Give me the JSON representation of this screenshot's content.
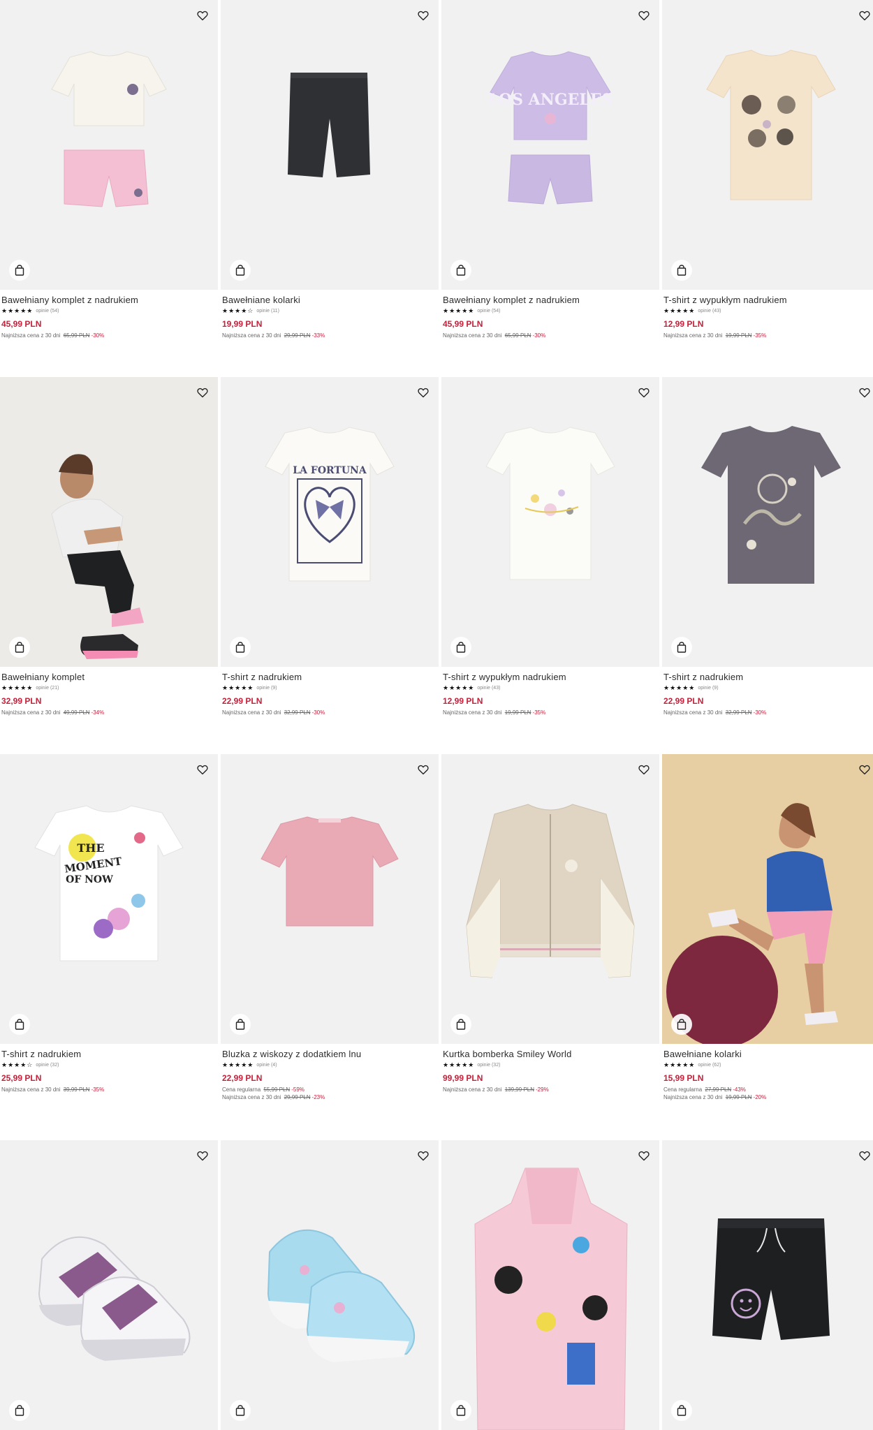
{
  "accent_color": "#c6213b",
  "icons": {
    "favorite": "heart-outline-icon",
    "add_to_bag": "shopping-bag-icon"
  },
  "products": [
    {
      "name": "Bawełniany komplet z nadrukiem",
      "stars": "★★★★★",
      "reviews": "opinie (54)",
      "price": "45,99 PLN",
      "regular_label": "",
      "regular_price": "",
      "regular_discount": "",
      "lowest_label": "Najniższa cena z 30 dni",
      "lowest_price": "65,99 PLN",
      "lowest_discount": "-30%",
      "art": "set-white",
      "image_text": ""
    },
    {
      "name": "Bawełniane kolarki",
      "stars": "★★★★☆",
      "reviews": "opinie (11)",
      "price": "19,99 PLN",
      "regular_label": "",
      "regular_price": "",
      "regular_discount": "",
      "lowest_label": "Najniższa cena z 30 dni",
      "lowest_price": "29,99 PLN",
      "lowest_discount": "-33%",
      "art": "shorts-black",
      "image_text": ""
    },
    {
      "name": "Bawełniany komplet z nadrukiem",
      "stars": "★★★★★",
      "reviews": "opinie (54)",
      "price": "45,99 PLN",
      "regular_label": "",
      "regular_price": "",
      "regular_discount": "",
      "lowest_label": "Najniższa cena z 30 dni",
      "lowest_price": "65,99 PLN",
      "lowest_discount": "-30%",
      "art": "set-lilac",
      "image_text": "LOS ANGELES"
    },
    {
      "name": "T-shirt z wypukłym nadrukiem",
      "stars": "★★★★★",
      "reviews": "opinie (43)",
      "price": "12,99 PLN",
      "regular_label": "",
      "regular_price": "",
      "regular_discount": "",
      "lowest_label": "Najniższa cena z 30 dni",
      "lowest_price": "19,99 PLN",
      "lowest_discount": "-35%",
      "art": "tee-cream",
      "image_text": ""
    },
    {
      "name": "Bawełniany komplet",
      "stars": "★★★★★",
      "reviews": "opinie (21)",
      "price": "32,99 PLN",
      "regular_label": "",
      "regular_price": "",
      "regular_discount": "",
      "lowest_label": "Najniższa cena z 30 dni",
      "lowest_price": "49,99 PLN",
      "lowest_discount": "-34%",
      "art": "model-squat",
      "image_text": ""
    },
    {
      "name": "T-shirt z nadrukiem",
      "stars": "★★★★★",
      "reviews": "opinie (9)",
      "price": "22,99 PLN",
      "regular_label": "",
      "regular_price": "",
      "regular_discount": "",
      "lowest_label": "Najniższa cena z 30 dni",
      "lowest_price": "32,99 PLN",
      "lowest_discount": "-30%",
      "art": "tee-fortuna",
      "image_text": "LA FORTUNA"
    },
    {
      "name": "T-shirt z wypukłym nadrukiem",
      "stars": "★★★★★",
      "reviews": "opinie (43)",
      "price": "12,99 PLN",
      "regular_label": "",
      "regular_price": "",
      "regular_discount": "",
      "lowest_label": "Najniższa cena z 30 dni",
      "lowest_price": "19,99 PLN",
      "lowest_discount": "-35%",
      "art": "tee-white-planets",
      "image_text": ""
    },
    {
      "name": "T-shirt z nadrukiem",
      "stars": "★★★★★",
      "reviews": "opinie (9)",
      "price": "22,99 PLN",
      "regular_label": "",
      "regular_price": "",
      "regular_discount": "",
      "lowest_label": "Najniższa cena z 30 dni",
      "lowest_price": "32,99 PLN",
      "lowest_discount": "-30%",
      "art": "tee-grey",
      "image_text": ""
    },
    {
      "name": "T-shirt z nadrukiem",
      "stars": "★★★★☆",
      "reviews": "opinie (32)",
      "price": "25,99 PLN",
      "regular_label": "",
      "regular_price": "",
      "regular_discount": "",
      "lowest_label": "Najniższa cena z 30 dni",
      "lowest_price": "39,99 PLN",
      "lowest_discount": "-35%",
      "art": "tee-moment",
      "image_text": "THE MOMENT OF NOW"
    },
    {
      "name": "Bluzka z wiskozy z dodatkiem lnu",
      "stars": "★★★★★",
      "reviews": "opinie (4)",
      "price": "22,99 PLN",
      "regular_label": "Cena regularna",
      "regular_price": "55,99 PLN",
      "regular_discount": "-59%",
      "lowest_label": "Najniższa cena z 30 dni",
      "lowest_price": "29,99 PLN",
      "lowest_discount": "-23%",
      "art": "top-pink",
      "image_text": ""
    },
    {
      "name": "Kurtka bomberka Smiley World",
      "stars": "★★★★★",
      "reviews": "opinie (32)",
      "price": "99,99 PLN",
      "regular_label": "",
      "regular_price": "",
      "regular_discount": "",
      "lowest_label": "Najniższa cena z 30 dni",
      "lowest_price": "139,99 PLN",
      "lowest_discount": "-29%",
      "art": "bomber",
      "image_text": ""
    },
    {
      "name": "Bawełniane kolarki",
      "stars": "★★★★★",
      "reviews": "opinie (62)",
      "price": "15,99 PLN",
      "regular_label": "Cena regularna",
      "regular_price": "27,99 PLN",
      "regular_discount": "-43%",
      "lowest_label": "Najniższa cena z 30 dni",
      "lowest_price": "19,99 PLN",
      "lowest_discount": "-20%",
      "art": "model-ball",
      "image_text": ""
    },
    {
      "name": "",
      "stars": "",
      "reviews": "",
      "price": "",
      "regular_label": "",
      "regular_price": "",
      "regular_discount": "",
      "lowest_label": "",
      "lowest_price": "",
      "lowest_discount": "",
      "art": "sneakers-white",
      "image_text": ""
    },
    {
      "name": "",
      "stars": "",
      "reviews": "",
      "price": "",
      "regular_label": "",
      "regular_price": "",
      "regular_discount": "",
      "lowest_label": "",
      "lowest_price": "",
      "lowest_discount": "",
      "art": "sneakers-blue",
      "image_text": ""
    },
    {
      "name": "",
      "stars": "",
      "reviews": "",
      "price": "",
      "regular_label": "",
      "regular_price": "",
      "regular_discount": "",
      "lowest_label": "",
      "lowest_price": "",
      "lowest_discount": "",
      "art": "towel-poncho",
      "image_text": ""
    },
    {
      "name": "",
      "stars": "",
      "reviews": "",
      "price": "",
      "regular_label": "",
      "regular_price": "",
      "regular_discount": "",
      "lowest_label": "",
      "lowest_price": "",
      "lowest_discount": "",
      "art": "shorts-smiley",
      "image_text": ""
    }
  ]
}
